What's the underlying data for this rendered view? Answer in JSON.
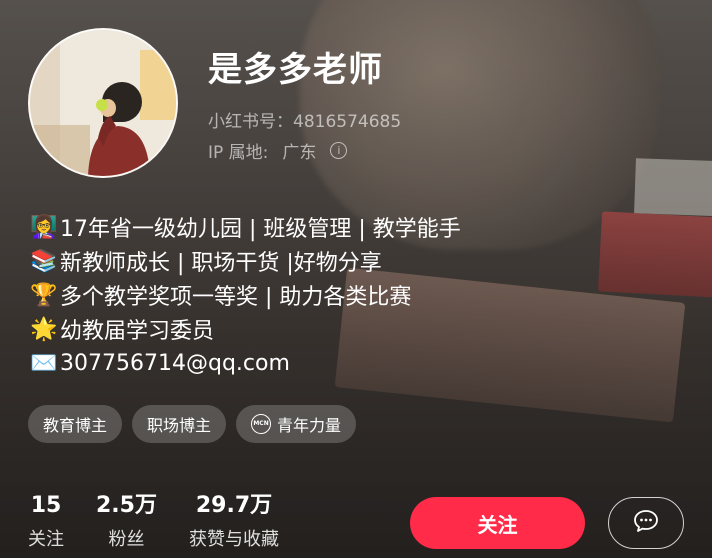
{
  "profile": {
    "name": "是多多老师",
    "id_label": "小红书号：",
    "id_value": "4816574685",
    "ip_label": "IP 属地:",
    "ip_value": "广东",
    "info_icon_glyph": "i"
  },
  "bio": [
    {
      "emoji": "👩‍🏫",
      "icon": "teacher-icon",
      "text": "17年省一级幼儿园 | 班级管理 | 教学能手"
    },
    {
      "emoji": "📚",
      "icon": "books-icon",
      "text": "新教师成长 | 职场干货 |好物分享"
    },
    {
      "emoji": "🏆",
      "icon": "trophy-icon",
      "text": "多个教学奖项一等奖 | 助力各类比赛"
    },
    {
      "emoji": "🌟",
      "icon": "star-icon",
      "text": "幼教届学习委员"
    },
    {
      "emoji": "✉️",
      "icon": "envelope-icon",
      "text": "307756714@qq.com"
    }
  ],
  "tags": [
    {
      "label": "教育博主"
    },
    {
      "label": "职场博主"
    },
    {
      "label": "青年力量",
      "icon_text": "MCN"
    }
  ],
  "stats": [
    {
      "value": "15",
      "label": "关注"
    },
    {
      "value": "2.5万",
      "label": "粉丝"
    },
    {
      "value": "29.7万",
      "label": "获赞与收藏"
    }
  ],
  "actions": {
    "follow_label": "关注",
    "message_icon": "chat-bubble-icon"
  },
  "colors": {
    "follow_button": "#ff2b48",
    "background": "#4a4440"
  }
}
